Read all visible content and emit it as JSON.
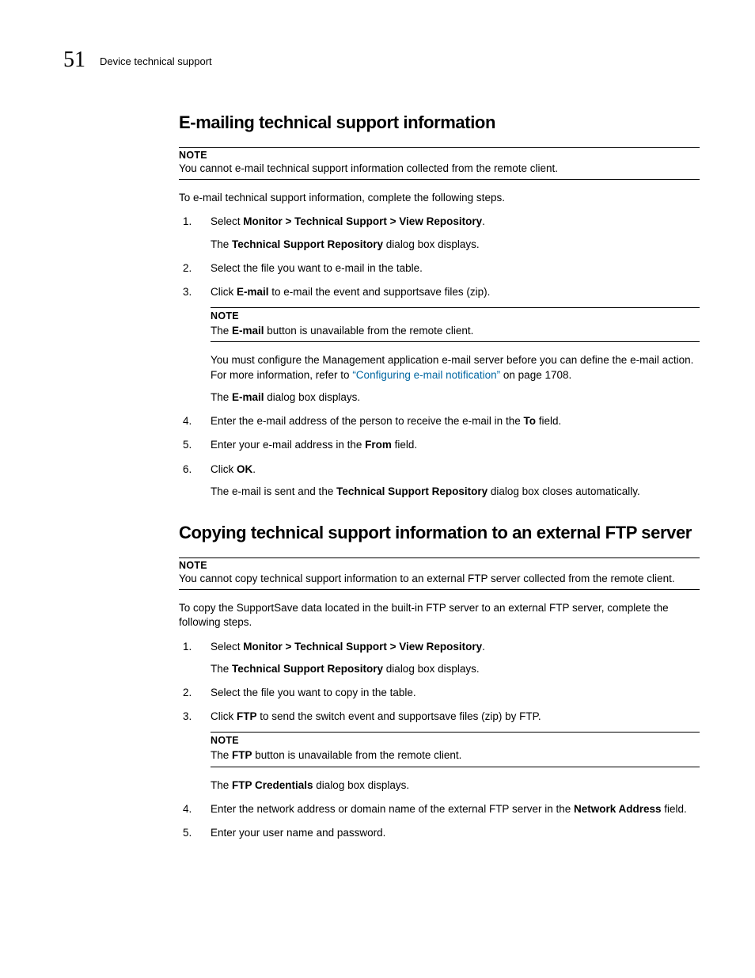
{
  "header": {
    "chapter_number": "51",
    "running_title": "Device technical support"
  },
  "section_email": {
    "heading": "E-mailing technical support information",
    "note_label": "NOTE",
    "note_text": "You cannot e-mail technical support information collected from the remote client.",
    "intro": "To e-mail technical support information, complete the following steps.",
    "steps": {
      "s1_a": "Select ",
      "s1_b": "Monitor > Technical Support > View Repository",
      "s1_c": ".",
      "s1_sub_a": "The ",
      "s1_sub_b": "Technical Support Repository",
      "s1_sub_c": " dialog box displays.",
      "s2": "Select the file you want to e-mail in the table.",
      "s3_a": "Click ",
      "s3_b": "E-mail",
      "s3_c": " to e-mail the event and supportsave files (zip).",
      "s3_note_label": "NOTE",
      "s3_note_a": "The ",
      "s3_note_b": "E-mail",
      "s3_note_c": " button is unavailable from the remote client.",
      "s3_para_a": "You must configure the Management application e-mail server before you can define the e-mail action. For more information, refer to ",
      "s3_para_link": "“Configuring e-mail notification”",
      "s3_para_b": " on page 1708.",
      "s3_sub2_a": "The ",
      "s3_sub2_b": "E-mail",
      "s3_sub2_c": " dialog box displays.",
      "s4_a": "Enter the e-mail address of the person to receive the e-mail in the ",
      "s4_b": "To",
      "s4_c": " field.",
      "s5_a": "Enter your e-mail address in the ",
      "s5_b": "From",
      "s5_c": " field.",
      "s6_a": "Click ",
      "s6_b": "OK",
      "s6_c": ".",
      "s6_sub_a": "The e-mail is sent and the ",
      "s6_sub_b": "Technical Support Repository",
      "s6_sub_c": " dialog box closes automatically."
    }
  },
  "section_ftp": {
    "heading": "Copying technical support information to an external FTP server",
    "note_label": "NOTE",
    "note_text": "You cannot copy technical support information to an external FTP server collected from the remote client.",
    "intro": "To copy the SupportSave data located in the built-in FTP server to an external FTP server, complete the following steps.",
    "steps": {
      "s1_a": "Select ",
      "s1_b": "Monitor > Technical Support > View Repository",
      "s1_c": ".",
      "s1_sub_a": "The ",
      "s1_sub_b": "Technical Support Repository",
      "s1_sub_c": " dialog box displays.",
      "s2": "Select the file you want to copy in the table.",
      "s3_a": "Click ",
      "s3_b": "FTP",
      "s3_c": " to send the switch event and supportsave files (zip) by FTP.",
      "s3_note_label": "NOTE",
      "s3_note_a": "The ",
      "s3_note_b": "FTP",
      "s3_note_c": " button is unavailable from the remote client.",
      "s3_sub2_a": "The ",
      "s3_sub2_b": "FTP Credentials",
      "s3_sub2_c": " dialog box displays.",
      "s4_a": "Enter the network address or domain name of the external FTP server in the ",
      "s4_b": "Network Address",
      "s4_c": " field.",
      "s5": "Enter your user name and password."
    }
  }
}
